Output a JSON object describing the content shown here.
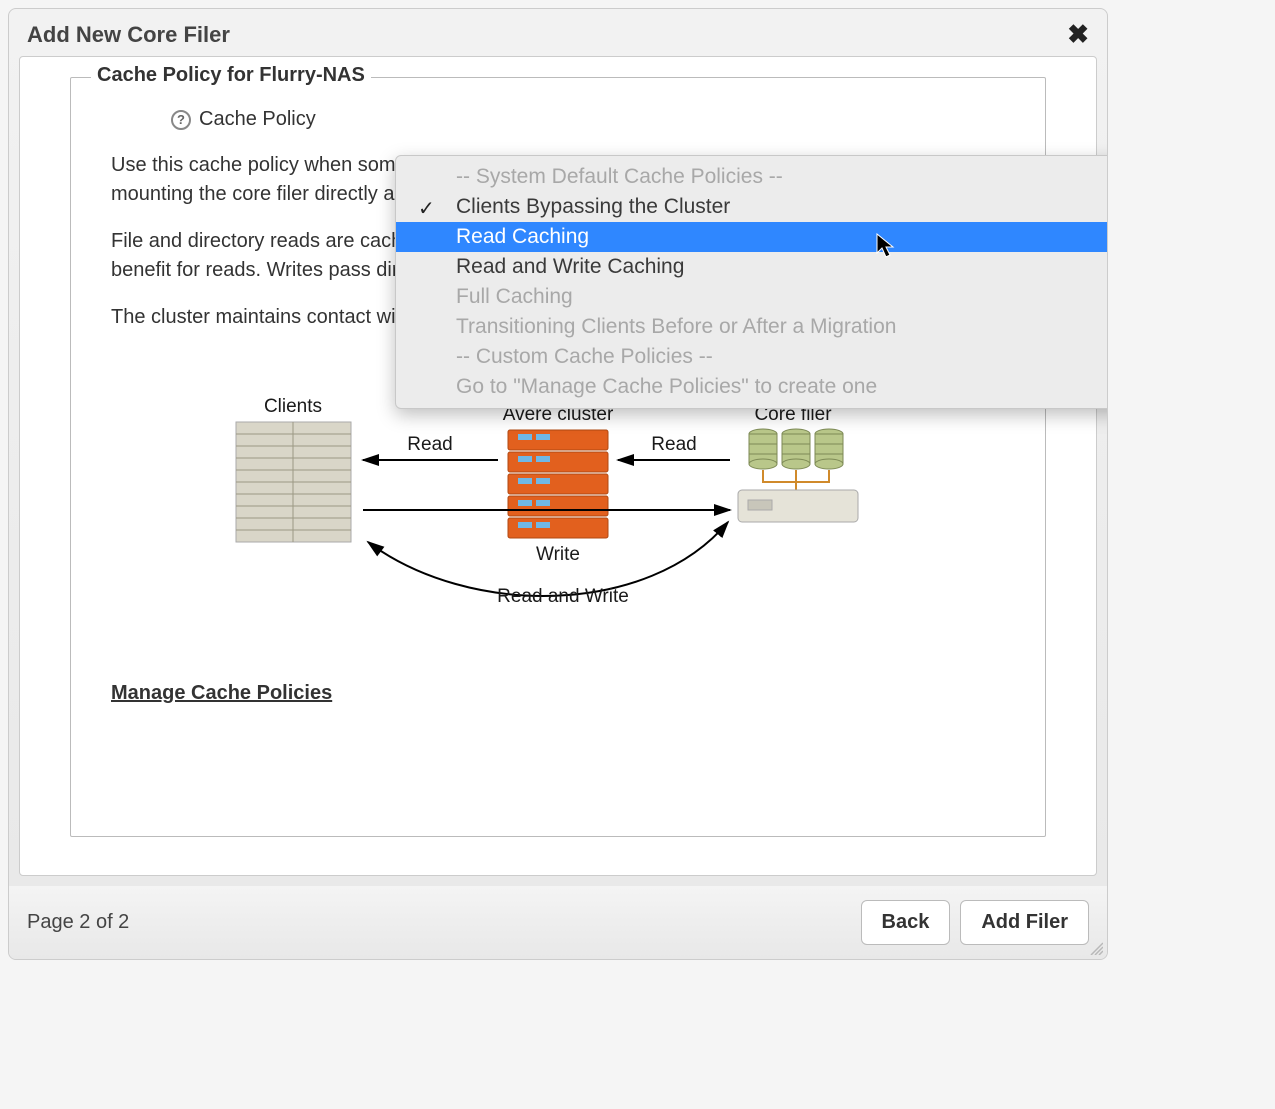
{
  "modal": {
    "title": "Add New Core Filer",
    "close_glyph": "✖"
  },
  "fieldset": {
    "legend": "Cache Policy for Flurry-NAS",
    "label": "Cache Policy"
  },
  "description": {
    "p1": "Use this cache policy when some of your clients are mounting the Avere cluster and others are mounting the core filer directly and neither group is expected to do any writes.",
    "p2": "File and directory reads are cached; clients mounting the Avere cluster will see a performance benefit for reads. Writes pass directly to the core filer.",
    "p3": "The cluster maintains contact with the core filer to maintain file system consistency."
  },
  "diagram": {
    "clients_label": "Clients",
    "cluster_label": "Avere cluster",
    "corefiler_label": "Core filer",
    "read_label_left": "Read",
    "read_label_right": "Read",
    "write_label": "Write",
    "readwrite_label": "Read and Write"
  },
  "manage_link": "Manage Cache Policies",
  "footer": {
    "page_indicator": "Page 2 of 2",
    "back_label": "Back",
    "add_label": "Add Filer"
  },
  "dropdown": {
    "header_system": "-- System Default Cache Policies --",
    "opt_bypass": "Clients Bypassing the Cluster",
    "opt_read": "Read Caching",
    "opt_rw": "Read and Write Caching",
    "opt_full": "Full Caching",
    "opt_trans": "Transitioning Clients Before or After a Migration",
    "header_custom": "-- Custom Cache Policies --",
    "opt_goto": "Go to \"Manage Cache Policies\" to create one",
    "selected": "opt_bypass",
    "highlighted": "opt_read"
  }
}
